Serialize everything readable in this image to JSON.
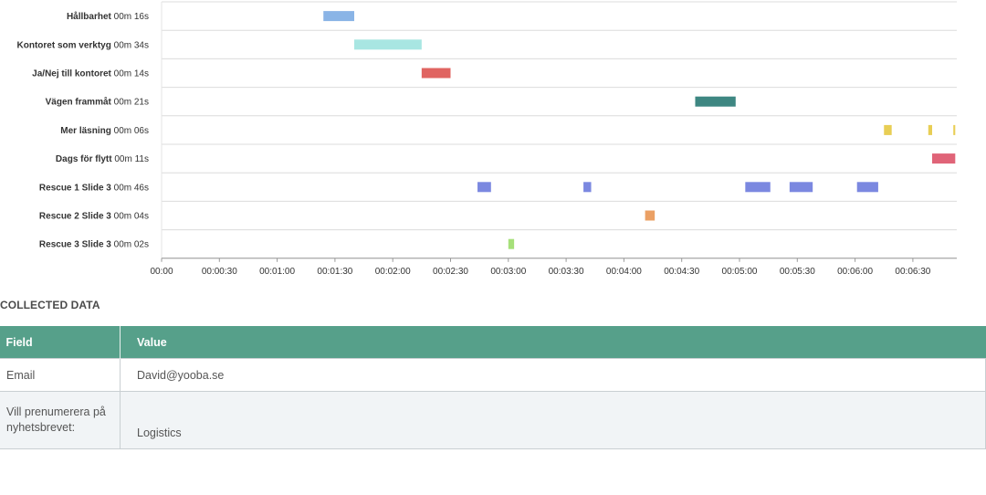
{
  "timeline": {
    "rows": [
      {
        "name": "Hållbarhet",
        "duration": "00m 16s",
        "color": "#8ab4e6",
        "segments": [
          [
            84,
            100
          ]
        ]
      },
      {
        "name": "Kontoret som verktyg",
        "duration": "00m 34s",
        "color": "#a8e6e2",
        "segments": [
          [
            100,
            135
          ]
        ]
      },
      {
        "name": "Ja/Nej till kontoret",
        "duration": "00m 14s",
        "color": "#e06461",
        "segments": [
          [
            135,
            150
          ]
        ]
      },
      {
        "name": "Vägen frammåt",
        "duration": "00m 21s",
        "color": "#3e8782",
        "segments": [
          [
            277,
            298
          ]
        ]
      },
      {
        "name": "Mer läsning",
        "duration": "00m 06s",
        "color": "#e8ce55",
        "segments": [
          [
            375,
            379
          ],
          [
            398,
            400
          ],
          [
            411,
            412
          ]
        ]
      },
      {
        "name": "Dags för flytt",
        "duration": "00m 11s",
        "color": "#e06478",
        "segments": [
          [
            400,
            412
          ]
        ]
      },
      {
        "name": "Rescue 1 Slide 3",
        "duration": "00m 46s",
        "color": "#7b88e0",
        "segments": [
          [
            164,
            171
          ],
          [
            219,
            223
          ],
          [
            303,
            316
          ],
          [
            326,
            338
          ],
          [
            361,
            372
          ]
        ]
      },
      {
        "name": "Rescue 2 Slide 3",
        "duration": "00m 04s",
        "color": "#eba064",
        "segments": [
          [
            251,
            256
          ]
        ]
      },
      {
        "name": "Rescue 3 Slide 3",
        "duration": "00m 02s",
        "color": "#a6e07a",
        "segments": [
          [
            180,
            183
          ]
        ]
      }
    ],
    "ticks": [
      "00:00",
      "00:00:30",
      "00:01:00",
      "00:01:30",
      "00:02:00",
      "00:02:30",
      "00:03:00",
      "00:03:30",
      "00:04:00",
      "00:04:30",
      "00:05:00",
      "00:05:30",
      "00:06:00",
      "00:06:30"
    ],
    "x_max_seconds": 412
  },
  "collected": {
    "title": "COLLECTED DATA",
    "headers": {
      "field": "Field",
      "value": "Value"
    },
    "rows": [
      {
        "field": "Email",
        "value": "David@yooba.se"
      },
      {
        "field": "Vill prenumerera på nyhetsbrevet:",
        "value": "Logistics"
      }
    ]
  }
}
